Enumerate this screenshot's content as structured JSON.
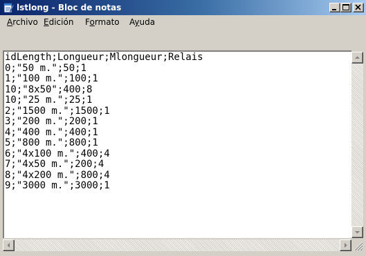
{
  "window": {
    "title": "lstlong - Bloc de notas",
    "icon": "notepad-icon",
    "controls": [
      "minimize-icon",
      "maximize-icon",
      "close-icon"
    ]
  },
  "menu": {
    "items": [
      {
        "label": "Archivo",
        "accel": "A"
      },
      {
        "label": "Edición",
        "accel": "E"
      },
      {
        "label": "Formato",
        "accel": "o"
      },
      {
        "label": "Ayuda",
        "accel": "y"
      }
    ]
  },
  "document": {
    "text": "idLength;Longueur;Mlongueur;Relais\n0;\"50 m.\";50;1\n1;\"100 m.\";100;1\n10;\"8x50\";400;8\n10;\"25 m.\";25;1\n2;\"1500 m.\";1500;1\n3;\"200 m.\";200;1\n4;\"400 m.\";400;1\n5;\"800 m.\";800;1\n6;\"4x100 m.\";400;4\n7;\"4x50 m.\";200;4\n8;\"4x200 m.\";800;4\n9;\"3000 m.\";3000;1"
  },
  "scrollbars": {
    "vertical": [
      "scroll-up-icon",
      "scroll-down-icon"
    ],
    "horizontal": [
      "scroll-left-icon",
      "scroll-right-icon"
    ]
  },
  "colors": {
    "titlebar_start": "#0a246a",
    "titlebar_end": "#a6caf0",
    "chrome": "#d4d0c8",
    "edit_background": "#ffffff"
  }
}
